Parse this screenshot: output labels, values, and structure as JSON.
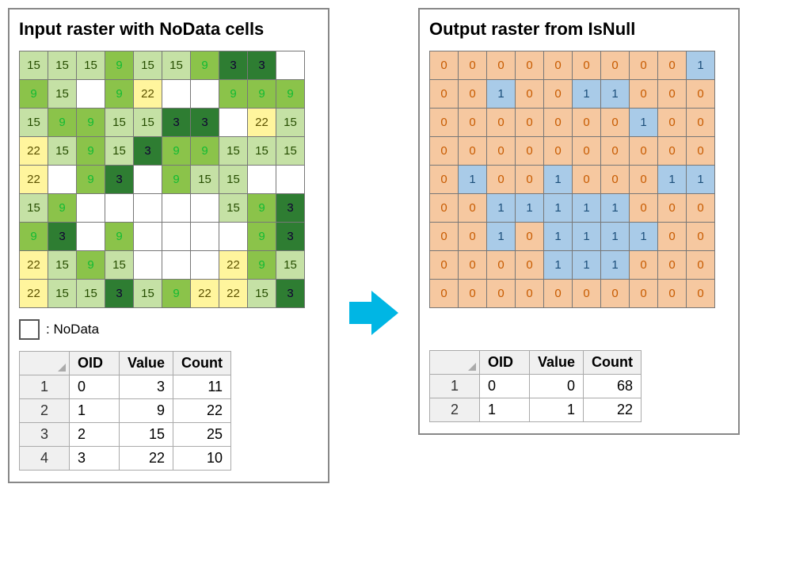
{
  "input": {
    "title": "Input raster with NoData cells",
    "legend_label": ": NoData",
    "grid": [
      [
        15,
        15,
        15,
        9,
        15,
        15,
        9,
        3,
        3,
        null
      ],
      [
        9,
        15,
        null,
        9,
        22,
        null,
        null,
        9,
        9,
        9
      ],
      [
        15,
        9,
        9,
        15,
        15,
        3,
        3,
        null,
        22,
        15
      ],
      [
        22,
        15,
        9,
        15,
        3,
        9,
        9,
        15,
        15,
        15
      ],
      [
        22,
        null,
        9,
        3,
        null,
        9,
        15,
        15,
        null,
        null
      ],
      [
        15,
        9,
        null,
        null,
        null,
        null,
        null,
        15,
        9,
        3
      ],
      [
        9,
        3,
        null,
        9,
        null,
        null,
        null,
        null,
        9,
        3
      ],
      [
        22,
        15,
        9,
        15,
        null,
        null,
        null,
        22,
        9,
        15
      ],
      [
        22,
        15,
        15,
        3,
        15,
        9,
        22,
        22,
        15,
        3
      ]
    ],
    "table": {
      "headers": [
        "OID",
        "Value",
        "Count"
      ],
      "rows": [
        {
          "n": 1,
          "oid": 0,
          "value": 3,
          "count": 11
        },
        {
          "n": 2,
          "oid": 1,
          "value": 9,
          "count": 22
        },
        {
          "n": 3,
          "oid": 2,
          "value": 15,
          "count": 25
        },
        {
          "n": 4,
          "oid": 3,
          "value": 22,
          "count": 10
        }
      ]
    }
  },
  "output": {
    "title": "Output raster from IsNull",
    "grid": [
      [
        0,
        0,
        0,
        0,
        0,
        0,
        0,
        0,
        0,
        1
      ],
      [
        0,
        0,
        1,
        0,
        0,
        1,
        1,
        0,
        0,
        0
      ],
      [
        0,
        0,
        0,
        0,
        0,
        0,
        0,
        1,
        0,
        0
      ],
      [
        0,
        0,
        0,
        0,
        0,
        0,
        0,
        0,
        0,
        0
      ],
      [
        0,
        1,
        0,
        0,
        1,
        0,
        0,
        0,
        1,
        1
      ],
      [
        0,
        0,
        1,
        1,
        1,
        1,
        1,
        0,
        0,
        0
      ],
      [
        0,
        0,
        1,
        0,
        1,
        1,
        1,
        1,
        0,
        0
      ],
      [
        0,
        0,
        0,
        0,
        1,
        1,
        1,
        0,
        0,
        0
      ],
      [
        0,
        0,
        0,
        0,
        0,
        0,
        0,
        0,
        0,
        0
      ]
    ],
    "table": {
      "headers": [
        "OID",
        "Value",
        "Count"
      ],
      "rows": [
        {
          "n": 1,
          "oid": 0,
          "value": 0,
          "count": 68
        },
        {
          "n": 2,
          "oid": 1,
          "value": 1,
          "count": 22
        }
      ]
    }
  }
}
